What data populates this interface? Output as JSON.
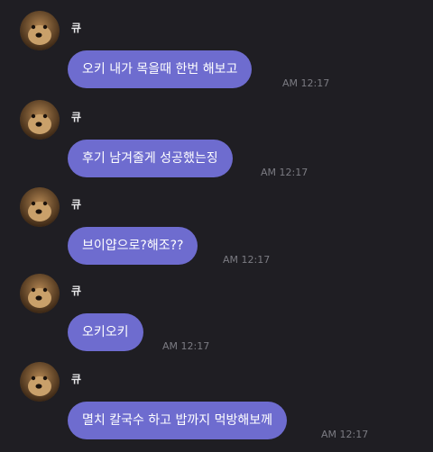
{
  "messages": [
    {
      "sender": "큐",
      "text": "오키 내가 목을때 한번 해보고",
      "time": "AM 12:17"
    },
    {
      "sender": "큐",
      "text": "후기 남겨줄게 성공했는징",
      "time": "AM 12:17"
    },
    {
      "sender": "큐",
      "text": "브이얍으로?해조??",
      "time": "AM 12:17"
    },
    {
      "sender": "큐",
      "text": "오키오키",
      "time": "AM 12:17"
    },
    {
      "sender": "큐",
      "text": "멸치 칼국수 하고 밥까지 먹방해보께",
      "time": "AM 12:17"
    }
  ]
}
